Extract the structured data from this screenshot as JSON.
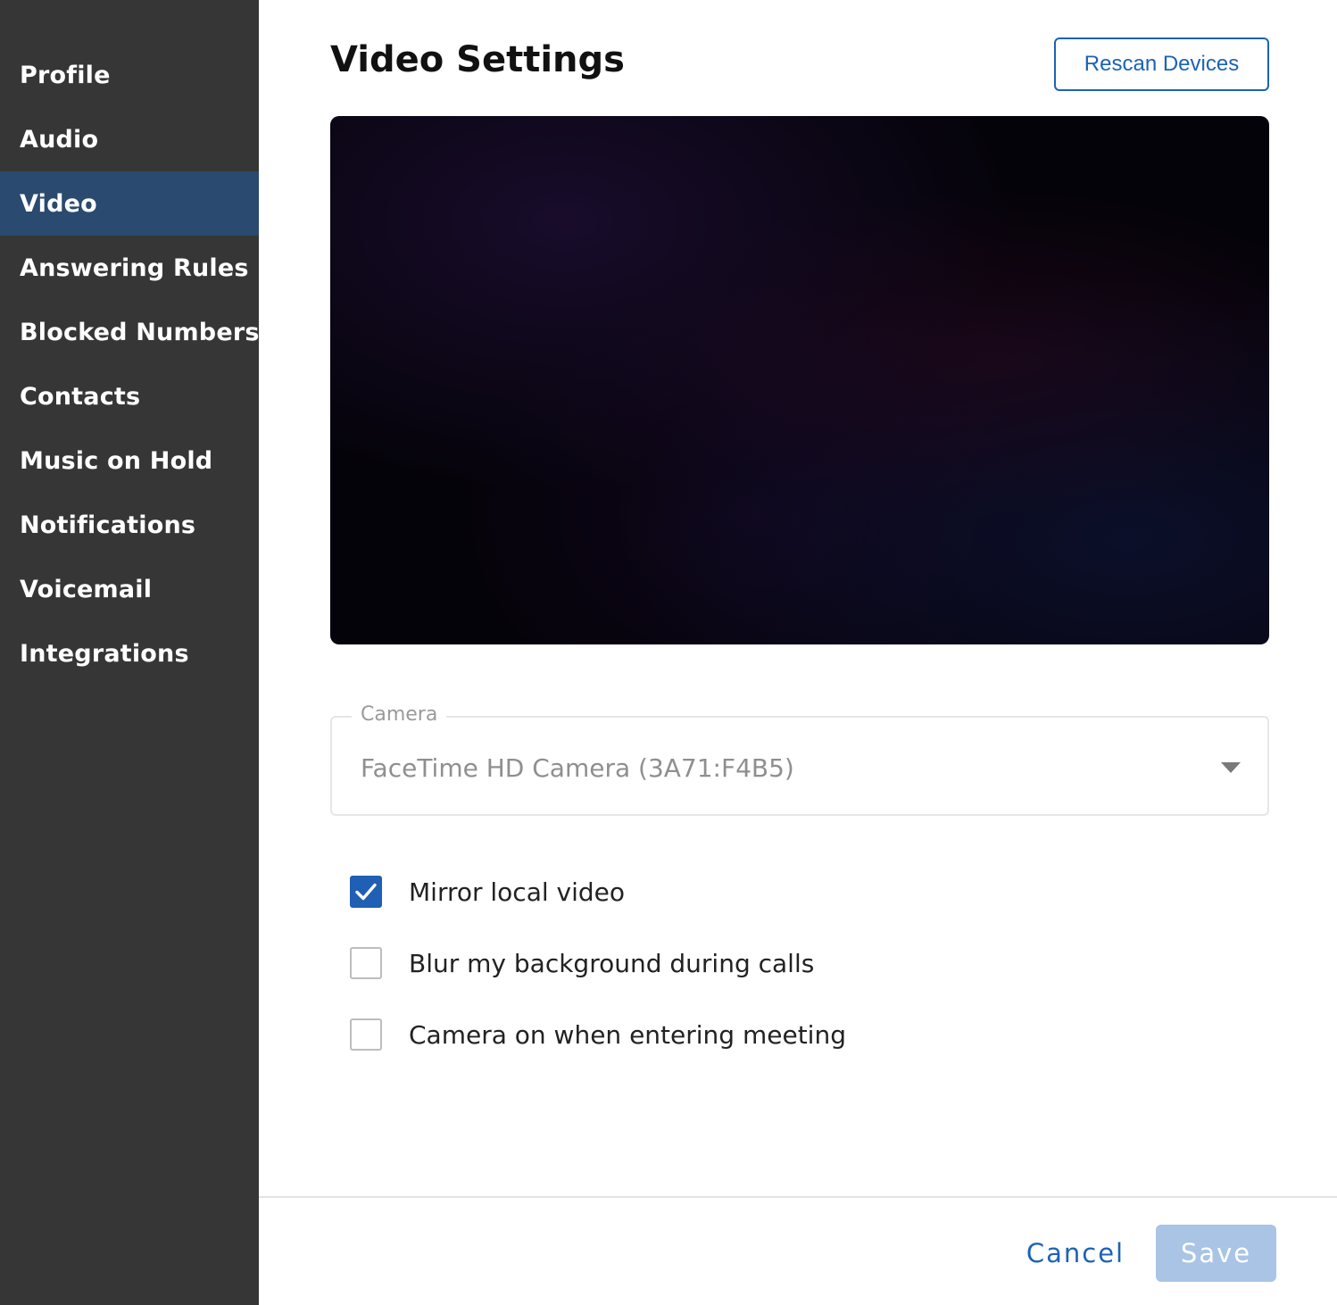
{
  "sidebar": {
    "items": [
      {
        "label": "Profile"
      },
      {
        "label": "Audio"
      },
      {
        "label": "Video",
        "active": true
      },
      {
        "label": "Answering Rules"
      },
      {
        "label": "Blocked Numbers"
      },
      {
        "label": "Contacts"
      },
      {
        "label": "Music on Hold"
      },
      {
        "label": "Notifications"
      },
      {
        "label": "Voicemail"
      },
      {
        "label": "Integrations"
      }
    ],
    "background": "#363636",
    "active_background": "#2a4a6f"
  },
  "main": {
    "title": "Video Settings",
    "rescan_label": "Rescan Devices",
    "camera": {
      "label": "Camera",
      "selected": "FaceTime HD Camera (3A71:F4B5)"
    },
    "options": [
      {
        "label": "Mirror local video",
        "checked": true
      },
      {
        "label": "Blur my background during calls",
        "checked": false
      },
      {
        "label": "Camera on when entering meeting",
        "checked": false
      }
    ]
  },
  "footer": {
    "cancel_label": "Cancel",
    "save_label": "Save"
  },
  "colors": {
    "accent": "#1b63b5",
    "checkbox_checked": "#1f5fb4",
    "save_disabled": "#a9c4e4"
  }
}
